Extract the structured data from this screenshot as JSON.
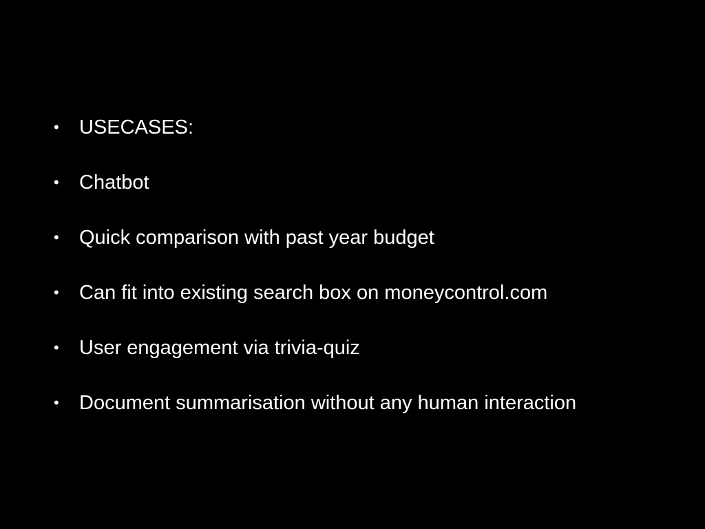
{
  "slide": {
    "background_color": "#000000",
    "text_color": "#ffffff",
    "bullet_glyph": "•",
    "bullets": [
      {
        "text": "USECASES:"
      },
      {
        "text": "Chatbot"
      },
      {
        "text": "Quick comparison with past year budget"
      },
      {
        "text": "Can fit into existing search box on moneycontrol.com"
      },
      {
        "text": "User engagement via trivia-quiz"
      },
      {
        "text": "Document summarisation without any human interaction"
      }
    ]
  }
}
